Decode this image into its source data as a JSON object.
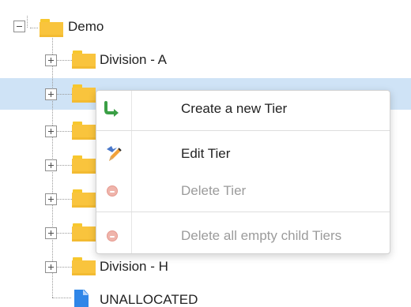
{
  "tree": {
    "root_label": "Demo",
    "nodes": [
      {
        "label": "Division - A"
      },
      {
        "label": ""
      },
      {
        "label": ""
      },
      {
        "label": ""
      },
      {
        "label": ""
      },
      {
        "label": ""
      },
      {
        "label": "Division - H"
      },
      {
        "label": "UNALLOCATED"
      }
    ],
    "selected_index": 1
  },
  "context_menu": {
    "items": [
      {
        "label": "Create a new Tier",
        "icon": "create-tier-icon",
        "enabled": true
      },
      {
        "label": "Edit Tier",
        "icon": "edit-tier-icon",
        "enabled": true
      },
      {
        "label": "Delete Tier",
        "icon": "delete-tier-icon",
        "enabled": false
      },
      {
        "label": "Delete all empty child Tiers",
        "icon": "delete-empty-child-tiers-icon",
        "enabled": false
      }
    ]
  },
  "colors": {
    "selection": "#cfe3f6",
    "folder": "#f9c43d",
    "document": "#2f86e8",
    "create_arrow": "#3a9f45",
    "disabled_icon": "#efb4ab"
  }
}
